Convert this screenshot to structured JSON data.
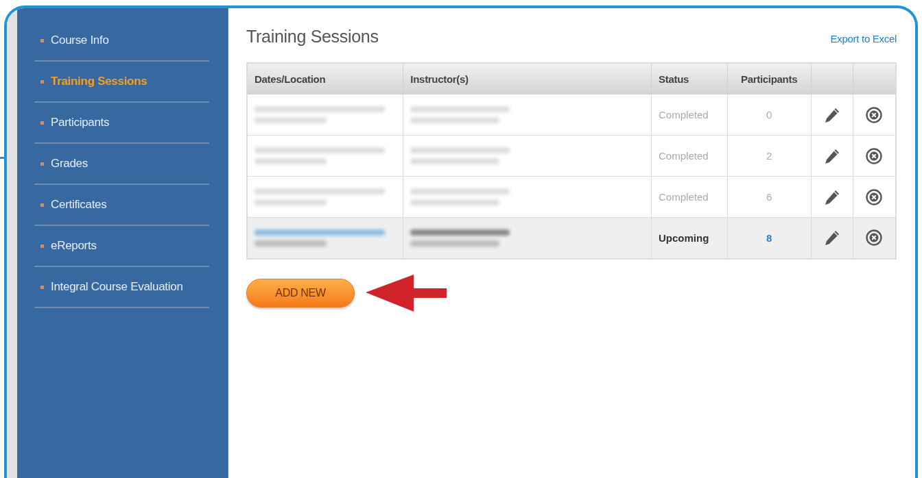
{
  "sidebar": {
    "items": [
      {
        "label": "Course Info",
        "selected": false
      },
      {
        "label": "Training Sessions",
        "selected": true
      },
      {
        "label": "Participants",
        "selected": false
      },
      {
        "label": "Grades",
        "selected": false
      },
      {
        "label": "Certificates",
        "selected": false
      },
      {
        "label": "eReports",
        "selected": false
      },
      {
        "label": "Integral Course Evaluation",
        "selected": false
      }
    ]
  },
  "page": {
    "title": "Training Sessions",
    "export_link": "Export to Excel"
  },
  "table": {
    "columns": [
      "Dates/Location",
      "Instructor(s)",
      "Status",
      "Participants"
    ],
    "rows": [
      {
        "kind": "completed",
        "status": "Completed",
        "participants": "0"
      },
      {
        "kind": "completed",
        "status": "Completed",
        "participants": "2"
      },
      {
        "kind": "completed",
        "status": "Completed",
        "participants": "6"
      },
      {
        "kind": "upcoming",
        "status": "Upcoming",
        "participants": "8"
      }
    ]
  },
  "add_button": "ADD NEW"
}
